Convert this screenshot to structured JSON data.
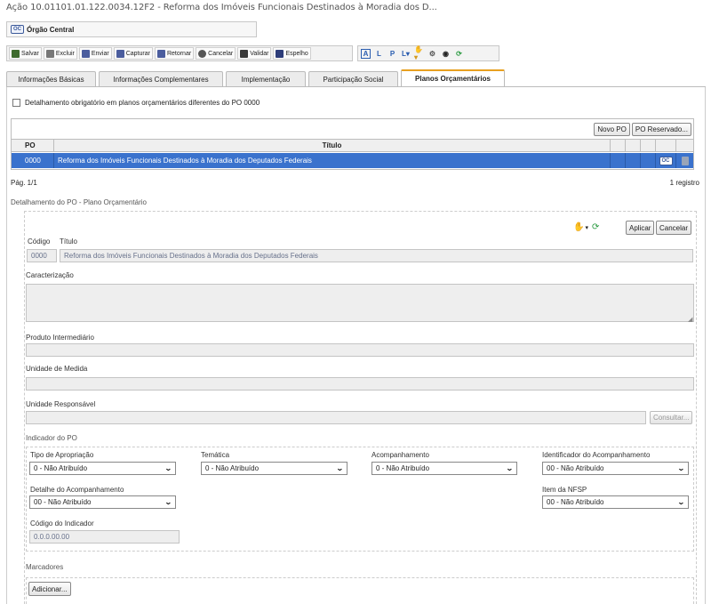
{
  "page_title": "Ação 10.01101.01.122.0034.12F2 - Reforma dos Imóveis Funcionais Destinados à Moradia dos D...",
  "orgao": {
    "tag": "OC",
    "label": "Órgão Central"
  },
  "toolbar": {
    "buttons": [
      {
        "label": "Salvar",
        "icon": "save-icon",
        "color": "#4a6a3a"
      },
      {
        "label": "Excluir",
        "icon": "trash-icon",
        "color": "#666666"
      },
      {
        "label": "Enviar",
        "icon": "monitor-send-icon",
        "color": "#5a5a9a"
      },
      {
        "label": "Capturar",
        "icon": "monitor-capture-icon",
        "color": "#5a5a9a"
      },
      {
        "label": "Retornar",
        "icon": "monitor-return-icon",
        "color": "#5a5a9a"
      },
      {
        "label": "Cancelar",
        "icon": "undo-icon",
        "color": "#555555"
      },
      {
        "label": "Validar",
        "icon": "hand-check-icon",
        "color": "#444444"
      },
      {
        "label": "Espelho",
        "icon": "printer-icon",
        "color": "#333366"
      }
    ],
    "secondary": [
      "A",
      "L",
      "P",
      "L",
      "hand",
      "gear",
      "eye",
      "refresh"
    ]
  },
  "tabs": [
    {
      "label": "Informações Básicas",
      "active": false
    },
    {
      "label": "Informações Complementares",
      "active": false
    },
    {
      "label": "Implementação",
      "active": false
    },
    {
      "label": "Participação Social",
      "active": false
    },
    {
      "label": "Planos Orçamentários",
      "active": true
    }
  ],
  "checkbox_label": "Detalhamento obrigatório em planos orçamentários diferentes do PO 0000",
  "grid": {
    "buttons": {
      "new": "Novo PO",
      "reserved": "PO Reservado..."
    },
    "headers": {
      "po": "PO",
      "title": "Título"
    },
    "row": {
      "po": "0000",
      "title": "Reforma dos Imóveis Funcionais Destinados à Moradia dos Deputados Federais",
      "tag": "OC"
    },
    "page": "Pág. 1/1",
    "count": "1 registro"
  },
  "detail": {
    "section_title": "Detalhamento do PO - Plano Orçamentário",
    "apply": "Aplicar",
    "cancel": "Cancelar",
    "codigo_label": "Código",
    "titulo_label": "Título",
    "codigo_value": "0000",
    "titulo_value": "Reforma dos Imóveis Funcionais Destinados à Moradia dos Deputados Federais",
    "caracterizacao_label": "Caracterização",
    "produto_label": "Produto Intermediário",
    "unidade_medida_label": "Unidade de Medida",
    "unidade_resp_label": "Unidade Responsável",
    "consultar": "Consultar..."
  },
  "indicador": {
    "title": "Indicador do PO",
    "tipo_label": "Tipo de Apropriação",
    "tipo_value": "0 - Não Atribuído",
    "tematica_label": "Temática",
    "tematica_value": "0 - Não Atribuído",
    "acomp_label": "Acompanhamento",
    "acomp_value": "0 - Não Atribuído",
    "ident_label": "Identificador do Acompanhamento",
    "ident_value": "00 - Não Atribuído",
    "detalhe_label": "Detalhe do Acompanhamento",
    "detalhe_value": "00 - Não Atribuído",
    "nfsp_label": "Item da NFSP",
    "nfsp_value": "00 - Não Atribuído",
    "codigo_label": "Código do Indicador",
    "codigo_value": "0.0.0.00.00"
  },
  "marcadores": {
    "title": "Marcadores",
    "add": "Adicionar..."
  }
}
